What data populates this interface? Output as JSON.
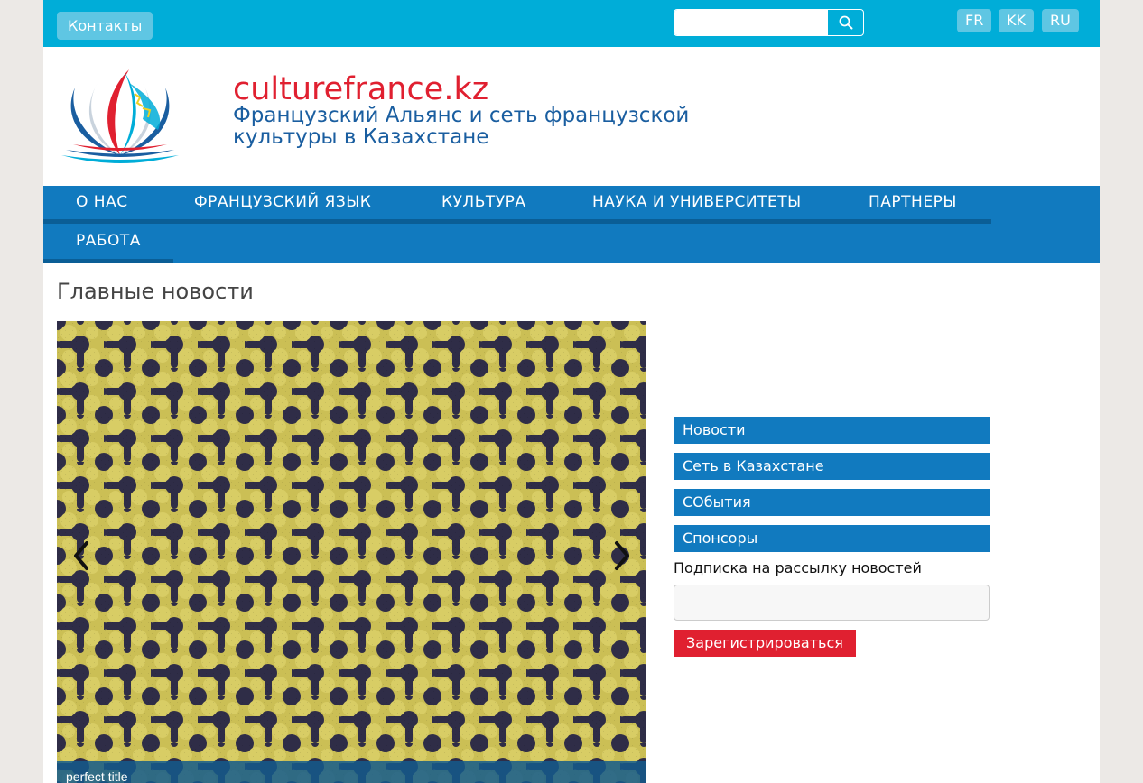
{
  "topbar": {
    "contacts_label": "Контакты",
    "search": {
      "value": "",
      "placeholder": ""
    },
    "languages": [
      "FR",
      "KK",
      "RU"
    ]
  },
  "header": {
    "site_title": "culturefrance.kz",
    "subtitle": "Французский Альянс и сеть французской культуры в Казахстане"
  },
  "nav": {
    "items": [
      "О НАС",
      "ФРАНЦУЗСКИЙ ЯЗЫК",
      "КУЛЬТУРА",
      "НАУКА И УНИВЕРСИТЕТЫ",
      "ПАРТНЕРЫ",
      "РАБОТА"
    ]
  },
  "main": {
    "heading": "Главные новости",
    "slider": {
      "caption": "perfect title"
    }
  },
  "sidebar": {
    "links": [
      "Новости",
      "Сеть в Казахстане",
      "СОбытия",
      "Спонсоры"
    ],
    "newsletter": {
      "label": "Подписка на рассылку новостей",
      "input_value": "",
      "button_label": "Зарегистрироваться"
    }
  },
  "colors": {
    "topbar": "#00add8",
    "nav": "#117abf",
    "accent_red": "#e02030",
    "title_blue": "#1a5ea0"
  }
}
